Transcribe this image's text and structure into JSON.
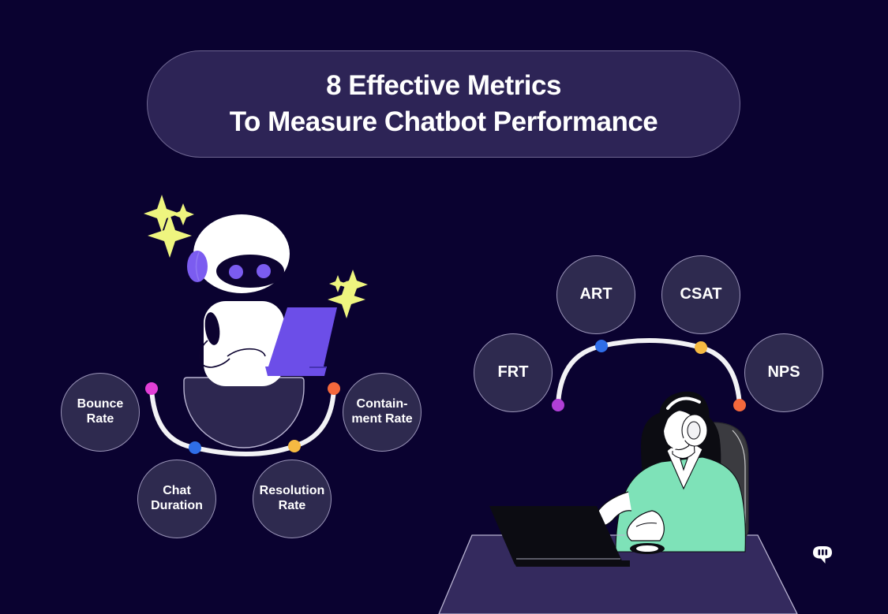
{
  "page": {
    "background_color": "#0a0230",
    "title_pill_color": "#2d2456",
    "circle_fill_color": "#2e2a4f",
    "circle_border_color": "#9a94b8"
  },
  "header": {
    "line1": "8 Effective Metrics",
    "line2": "To Measure Chatbot Performance"
  },
  "left_cluster": {
    "metrics": [
      {
        "label": "Bounce Rate",
        "dot_color": "#e23fd6",
        "name": "bounce-rate"
      },
      {
        "label": "Chat Duration",
        "dot_color": "#2f6ee8",
        "name": "chat-duration"
      },
      {
        "label": "Resolution Rate",
        "dot_color": "#f5b942",
        "name": "resolution-rate"
      },
      {
        "label": "Containment Rate",
        "dot_color": "#f4683c",
        "name": "containment-rate"
      }
    ],
    "metric_0_line1": "Bounce",
    "metric_0_line2": "Rate",
    "metric_1_line1": "Chat",
    "metric_1_line2": "Duration",
    "metric_2_line1": "Resolution",
    "metric_2_line2": "Rate",
    "metric_3_line1": "Contain-",
    "metric_3_line2": "ment Rate"
  },
  "right_cluster": {
    "metrics": [
      {
        "label": "FRT",
        "dot_color": "#b03fd6",
        "name": "frt"
      },
      {
        "label": "ART",
        "dot_color": "#2f6ee8",
        "name": "art"
      },
      {
        "label": "CSAT",
        "dot_color": "#f5b942",
        "name": "csat"
      },
      {
        "label": "NPS",
        "dot_color": "#f4683c",
        "name": "nps"
      }
    ]
  },
  "illustrations": {
    "robot_label": "chatbot-robot-at-laptop",
    "agent_label": "support-agent-at-laptop",
    "sparkle_color": "#eef57f",
    "robot_accent_color": "#7b5cf0",
    "agent_sweater_color": "#7ee2b8",
    "desk_color": "#342a5e"
  },
  "logo": {
    "name": "chat-bubble-logo",
    "color": "#ffffff"
  }
}
